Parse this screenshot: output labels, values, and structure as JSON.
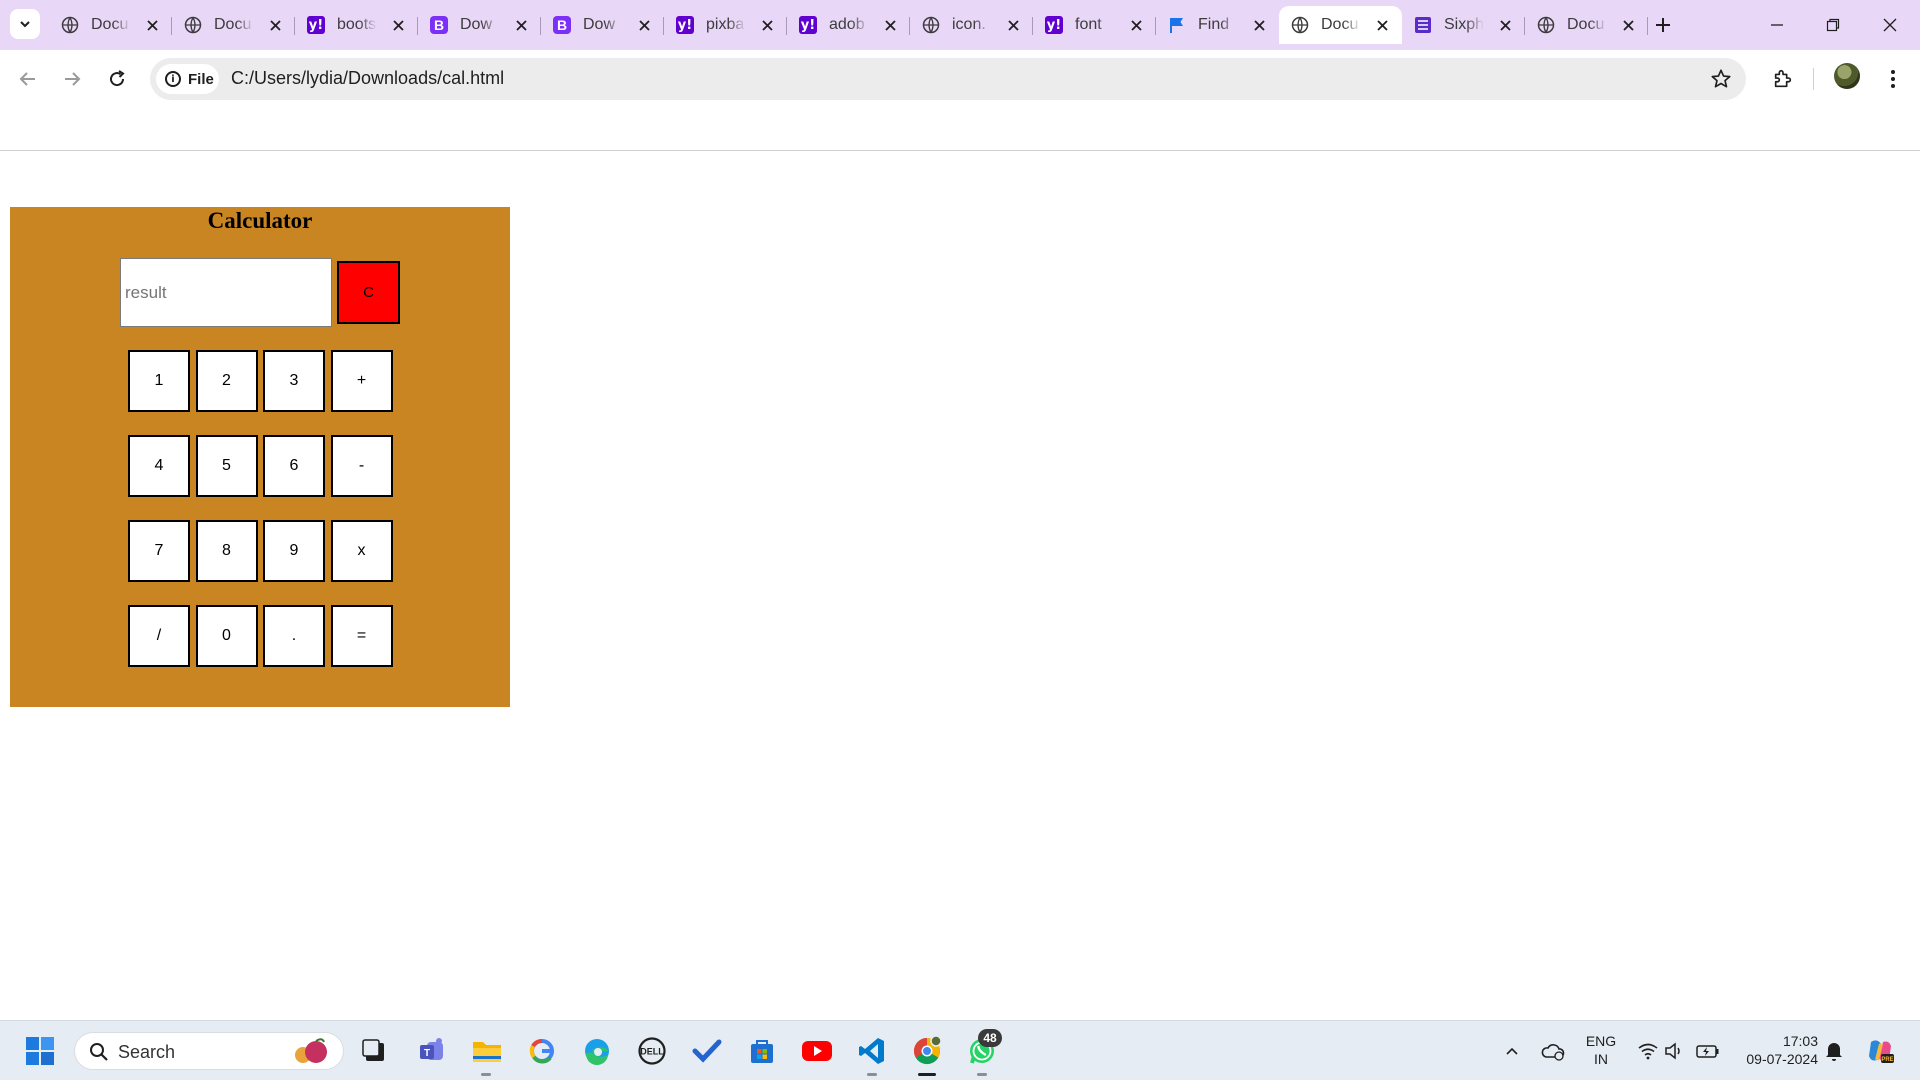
{
  "browser": {
    "tabs": [
      {
        "title": "Docu",
        "icon": "globe-icon",
        "active": false
      },
      {
        "title": "Docu",
        "icon": "globe-icon",
        "active": false
      },
      {
        "title": "boots",
        "icon": "yahoo-icon",
        "active": false
      },
      {
        "title": "Dow",
        "icon": "bootstrap-icon",
        "active": false
      },
      {
        "title": "Dow",
        "icon": "bootstrap-icon",
        "active": false
      },
      {
        "title": "pixba",
        "icon": "yahoo-icon",
        "active": false
      },
      {
        "title": "adob",
        "icon": "yahoo-icon",
        "active": false
      },
      {
        "title": "icon.",
        "icon": "globe-icon",
        "active": false
      },
      {
        "title": "font",
        "icon": "yahoo-icon",
        "active": false
      },
      {
        "title": "Find",
        "icon": "flag-icon",
        "active": false
      },
      {
        "title": "Docu",
        "icon": "globe-icon",
        "active": true
      },
      {
        "title": "Sixph",
        "icon": "list-icon",
        "active": false
      },
      {
        "title": "Docu",
        "icon": "globe-icon",
        "active": false
      }
    ],
    "address": {
      "chip_label": "File",
      "url": "C:/Users/lydia/Downloads/cal.html"
    },
    "colors": {
      "tabstrip": "#e9d7f7",
      "omnibox": "#ececec"
    }
  },
  "calculator": {
    "title": "Calculator",
    "result_placeholder": "result",
    "clear_label": "C",
    "keys": [
      "1",
      "2",
      "3",
      "+",
      "4",
      "5",
      "6",
      "-",
      "7",
      "8",
      "9",
      "x",
      "/",
      "0",
      ".",
      "="
    ],
    "colors": {
      "panel": "#c88522",
      "clear": "#ff0000"
    }
  },
  "taskbar": {
    "search_label": "Search",
    "whatsapp_badge": "48",
    "language": "ENG",
    "region": "IN",
    "time": "17:03",
    "date": "09-07-2024",
    "apps": [
      "start-icon",
      "task-view-icon",
      "teams-icon",
      "file-explorer-icon",
      "google-icon",
      "edge-icon",
      "dell-icon",
      "todo-icon",
      "store-icon",
      "youtube-icon",
      "vscode-icon",
      "chrome-icon",
      "whatsapp-icon"
    ]
  }
}
